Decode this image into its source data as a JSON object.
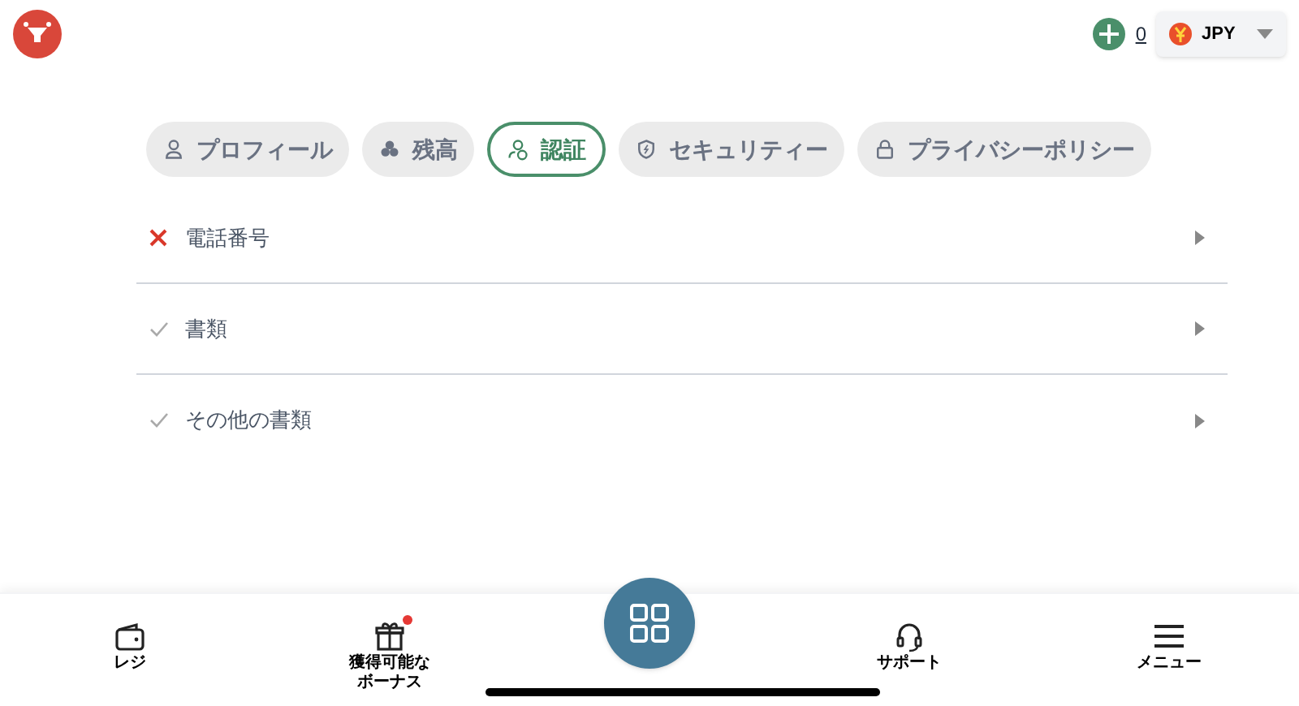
{
  "header": {
    "balance": "0",
    "currency": "JPY"
  },
  "tabs": [
    {
      "label": "プロフィール",
      "selected": false
    },
    {
      "label": "残高",
      "selected": false
    },
    {
      "label": "認証",
      "selected": true
    },
    {
      "label": "セキュリティー",
      "selected": false
    },
    {
      "label": "プライバシーポリシー",
      "selected": false
    }
  ],
  "verification_items": [
    {
      "label": "電話番号",
      "verified": false
    },
    {
      "label": "書類",
      "verified": true
    },
    {
      "label": "その他の書類",
      "verified": true
    }
  ],
  "bottom_nav": [
    {
      "label": "レジ",
      "badge": false
    },
    {
      "label": "獲得可能なボーナス",
      "badge": true
    },
    {
      "label": "サポート",
      "badge": false
    },
    {
      "label": "メニュー",
      "badge": false
    }
  ]
}
